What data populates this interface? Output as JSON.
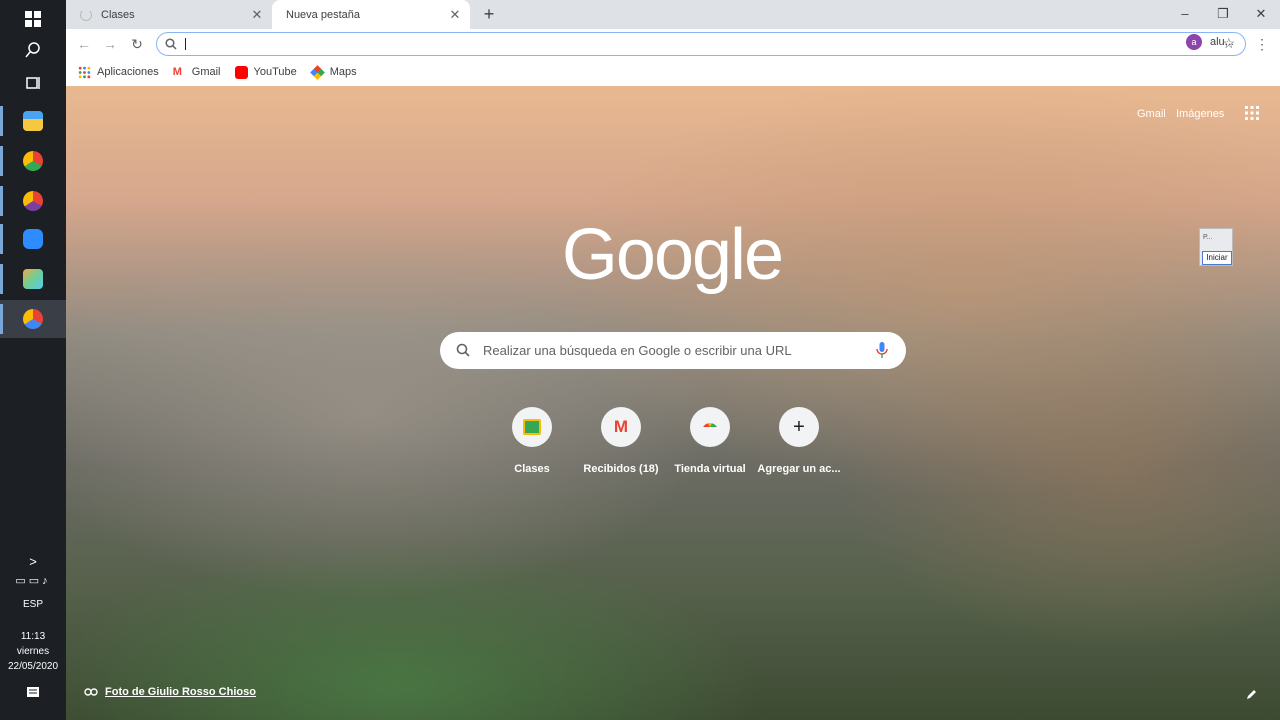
{
  "taskbar": {
    "tray": {
      "language": "ESP",
      "time": "11:13",
      "day": "viernes",
      "date": "22/05/2020",
      "expand": ">"
    }
  },
  "browser": {
    "tabs": [
      {
        "label": "Clases"
      },
      {
        "label": "Nueva pestaña"
      }
    ],
    "omnibox": {
      "value": ""
    },
    "profile": {
      "initial": "a",
      "name": "alu..."
    },
    "bookmarks": [
      {
        "label": "Aplicaciones"
      },
      {
        "label": "Gmail"
      },
      {
        "label": "YouTube"
      },
      {
        "label": "Maps"
      }
    ]
  },
  "ntp": {
    "header_links": {
      "gmail": "Gmail",
      "images": "Imágenes"
    },
    "logo": "Google",
    "search_placeholder": "Realizar una búsqueda en Google o escribir una URL",
    "shortcuts": [
      {
        "label": "Clases"
      },
      {
        "label": "Recibidos (18)"
      },
      {
        "label": "Tienda virtual"
      },
      {
        "label": "Agregar un ac..."
      }
    ],
    "extension_popup": {
      "title": "P...",
      "button": "Iniciar"
    },
    "attribution": "Foto de Giulio Rosso Chioso"
  },
  "colors": {
    "accent": "#8ab4f8",
    "taskbar": "#1c1f24",
    "tabstrip": "#dee1e6"
  }
}
